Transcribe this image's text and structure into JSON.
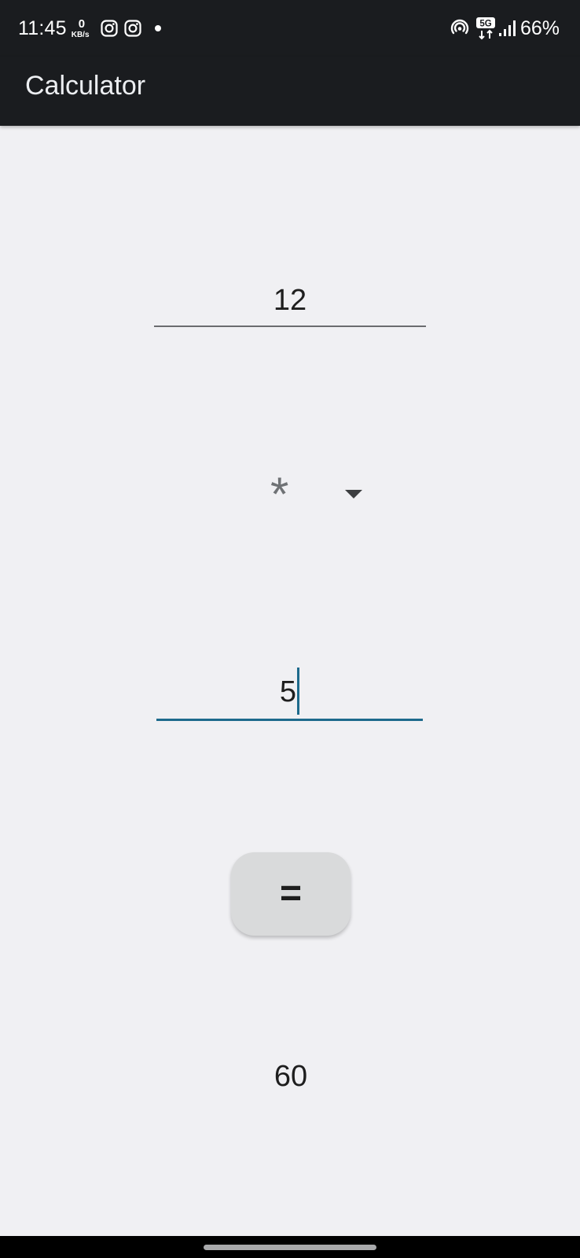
{
  "status_bar": {
    "time": "11:45",
    "net_speed_value": "0",
    "net_speed_unit": "KB/s",
    "network": "5G",
    "battery": "66%",
    "icons": [
      "instagram-icon",
      "instagram-icon",
      "notification-dot",
      "hotspot-icon",
      "5g-data-icon",
      "signal-icon"
    ]
  },
  "app_bar": {
    "title": "Calculator"
  },
  "calculator": {
    "first_operand": "12",
    "operator": "*",
    "second_operand": "5",
    "equals_label": "=",
    "result": "60"
  },
  "colors": {
    "bar_background": "#1a1c1f",
    "page_background": "#f0f0f3",
    "accent": "#1d6a8c",
    "button_background": "#d9dadb"
  }
}
